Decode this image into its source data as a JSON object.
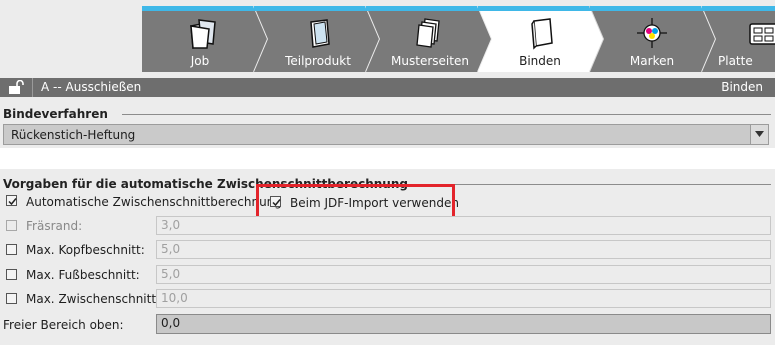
{
  "tabs": [
    {
      "label": "Job",
      "icon": "folder-document-icon",
      "active": false
    },
    {
      "label": "Teilprodukt",
      "icon": "book-icon",
      "active": false
    },
    {
      "label": "Musterseiten",
      "icon": "stacked-pages-icon",
      "active": false
    },
    {
      "label": "Binden",
      "icon": "bound-book-icon",
      "active": true
    },
    {
      "label": "Marken",
      "icon": "registration-mark-icon",
      "active": false
    },
    {
      "label": "Platte",
      "icon": "plate-icon",
      "active": false
    }
  ],
  "titlebar": {
    "left_text": "A -- Ausschießen",
    "right_text": "Binden"
  },
  "bindeverfahren": {
    "heading": "Bindeverfahren",
    "selected": "Rückenstich-Heftung"
  },
  "vorgaben": {
    "heading": "Vorgaben für die automatische Zwischenschnittberechnung",
    "auto_label": "Automatische Zwischenschnittberechnung",
    "auto_checked": true,
    "jdf_label": "Beim JDF-Import verwenden",
    "jdf_checked": true,
    "rows": [
      {
        "label": "Fräsrand:",
        "value": "3,0",
        "checked": false,
        "enabled": false
      },
      {
        "label": "Max. Kopfbeschnitt:",
        "value": "5,0",
        "checked": false,
        "enabled": true
      },
      {
        "label": "Max. Fußbeschnitt:",
        "value": "5,0",
        "checked": false,
        "enabled": true
      },
      {
        "label": "Max. Zwischenschnitt:",
        "value": "10,0",
        "checked": false,
        "enabled": true
      }
    ],
    "freier_label": "Freier Bereich oben:",
    "freier_value": "0,0"
  },
  "colors": {
    "accent": "#3fb8e8",
    "tab_bg": "#7a7a7a",
    "highlight": "#e3242b"
  }
}
